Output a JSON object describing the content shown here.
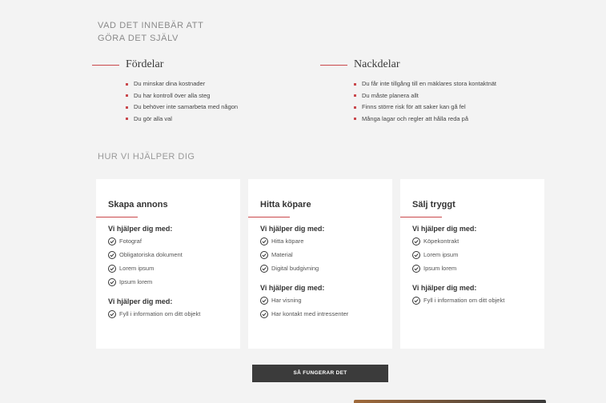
{
  "intro": {
    "line1": "VAD DET INNEBÄR ATT",
    "line2": "GÖRA DET SJÄLV"
  },
  "pros": {
    "title": "Fördelar",
    "items": [
      "Du minskar dina kostnader",
      "Du har kontroll över alla steg",
      "Du behöver inte samarbeta med någon",
      "Du gör alla val"
    ]
  },
  "cons": {
    "title": "Nackdelar",
    "items": [
      "Du får inte tillgång till en mäklares stora kontaktnät",
      "Du måste planera allt",
      "Finns större risk för att saker kan gå fel",
      "Många lagar och regler att hålla reda på"
    ]
  },
  "help": {
    "heading": "HUR VI HJÄLPER DIG",
    "cards": [
      {
        "title": "Skapa annons",
        "groups": [
          {
            "title": "Vi hjälper dig med:",
            "items": [
              "Fotograf",
              "Obligatoriska dokument",
              "Lorem ipsum",
              "Ipsum lorem"
            ]
          },
          {
            "title": "Vi hjälper dig med:",
            "items": [
              "Fyll i information om ditt objekt"
            ]
          }
        ]
      },
      {
        "title": "Hitta köpare",
        "groups": [
          {
            "title": "Vi hjälper dig med:",
            "items": [
              "Hitta köpare",
              "Material",
              "Digital budgivning"
            ]
          },
          {
            "title": "Vi hjälper dig med:",
            "items": [
              "Har visning",
              "Har kontakt med intressenter"
            ]
          }
        ]
      },
      {
        "title": "Sälj tryggt",
        "groups": [
          {
            "title": "Vi hjälper dig med:",
            "items": [
              "Köpekontrakt",
              "Lorem ipsum",
              "Ipsum lorem"
            ]
          },
          {
            "title": "Vi hjälper dig med:",
            "items": [
              "Fyll i information om ditt objekt"
            ]
          }
        ]
      }
    ]
  },
  "cta": {
    "label": "SÅ FUNGERAR DET"
  },
  "colors": {
    "accent": "#c9474b",
    "button": "#3b3b3b",
    "background": "#f3f3f3",
    "card": "#ffffff"
  }
}
